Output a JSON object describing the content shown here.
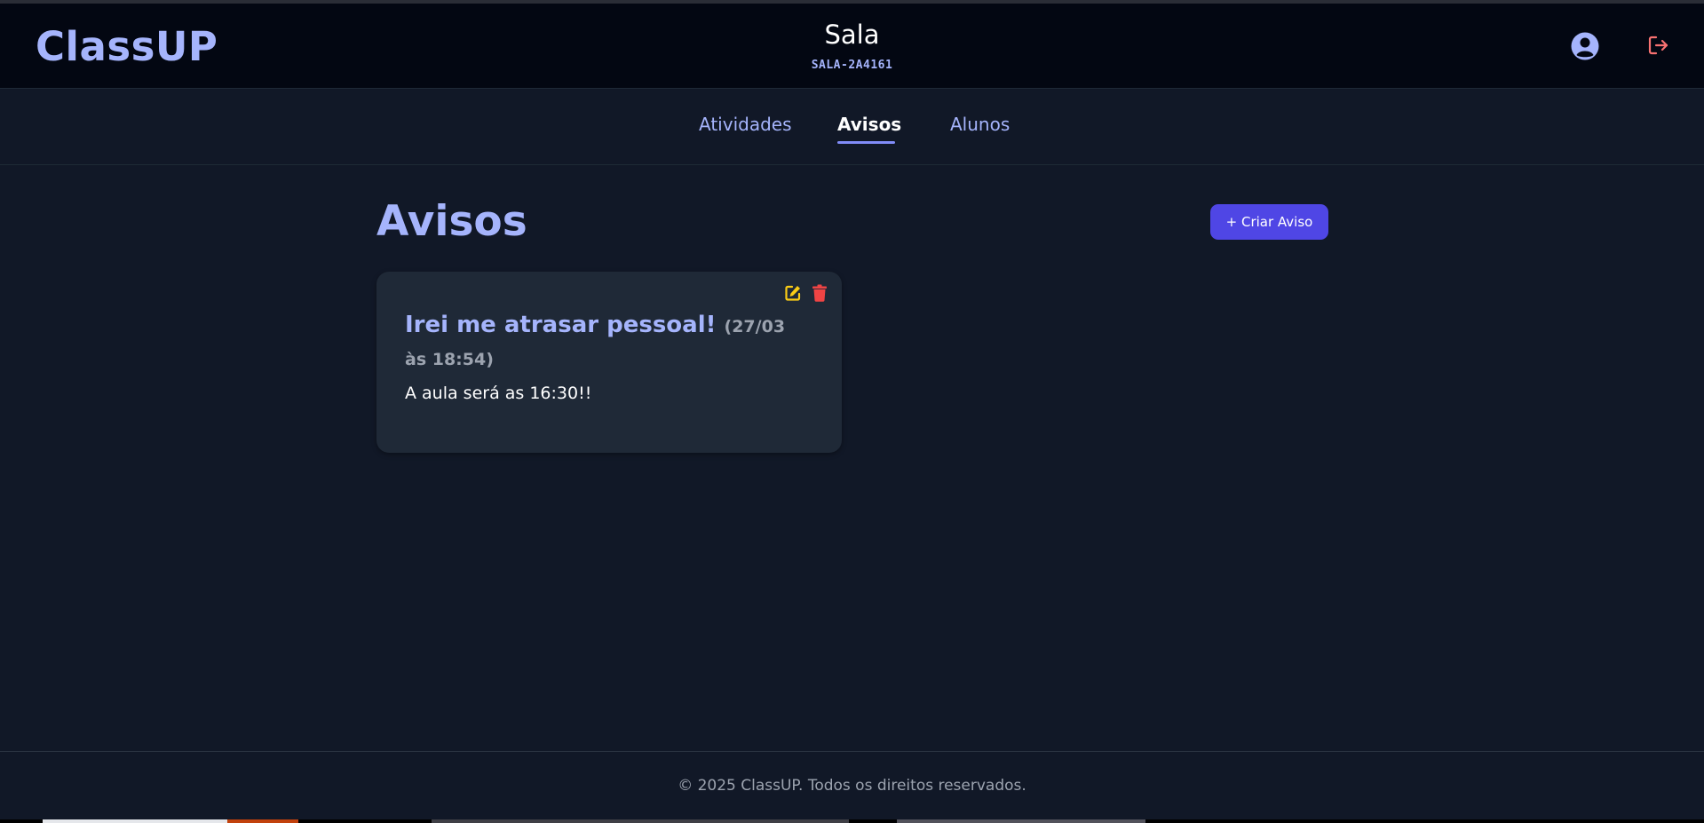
{
  "header": {
    "logo": "ClassUP",
    "room_title": "Sala",
    "room_code": "SALA-2A4161",
    "user_icon": "user-circle-icon",
    "logout_icon": "logout-icon"
  },
  "tabs": [
    {
      "label": "Atividades",
      "active": false
    },
    {
      "label": "Avisos",
      "active": true
    },
    {
      "label": "Alunos",
      "active": false
    }
  ],
  "main": {
    "title": "Avisos",
    "create_button": "+ Criar Aviso"
  },
  "notices": [
    {
      "title": "Irei me atrasar pessoal!",
      "date": "(27/03 às 18:54)",
      "body": "A aula será as 16:30!!",
      "edit_icon": "edit-icon",
      "delete_icon": "trash-icon"
    }
  ],
  "footer": {
    "text": "© 2025 ClassUP. Todos os direitos reservados."
  },
  "colors": {
    "background": "#111827",
    "header_bg": "#030712",
    "accent": "#a5b4fc",
    "button": "#4f46e5",
    "edit": "#facc15",
    "delete": "#ef4444",
    "logout": "#f87171"
  }
}
